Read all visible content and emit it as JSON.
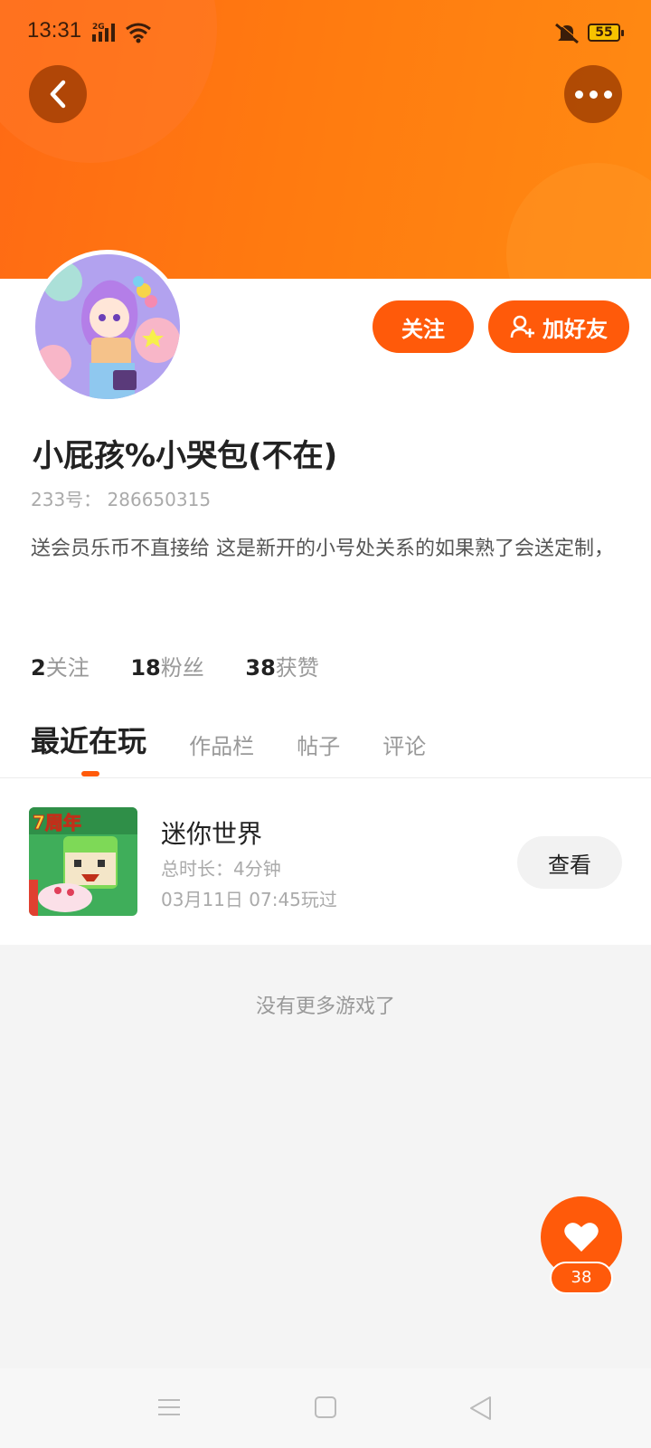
{
  "status_bar": {
    "time": "13:31",
    "network": "2G",
    "battery": "55"
  },
  "profile": {
    "follow_label": "关注",
    "add_friend_label": "加好友",
    "username": "小屁孩%小哭包(不在)",
    "uid": "233号： 286650315",
    "bio": "送会员乐币不直接给 这是新开的小号处关系的如果熟了会送定制，",
    "stats": [
      {
        "num": "2",
        "label": "关注"
      },
      {
        "num": "18",
        "label": "粉丝"
      },
      {
        "num": "38",
        "label": "获赞"
      }
    ]
  },
  "tabs": [
    "最近在玩",
    "作品栏",
    "帖子",
    "评论"
  ],
  "recent_game": {
    "badge": "7周年",
    "name": "迷你世界",
    "total_time": "总时长：4分钟",
    "last_played": "03月11日 07:45玩过",
    "view_label": "查看"
  },
  "no_more_text": "没有更多游戏了",
  "like": {
    "count": "38"
  },
  "colors": {
    "accent": "#ff5a0a",
    "header_start": "#ff6a14",
    "header_end": "#ff8a12"
  },
  "icons": [
    "back-arrow-icon",
    "more-dots-icon",
    "add-user-icon",
    "heart-icon",
    "menu-icon",
    "home-square-icon",
    "back-triangle-icon"
  ]
}
